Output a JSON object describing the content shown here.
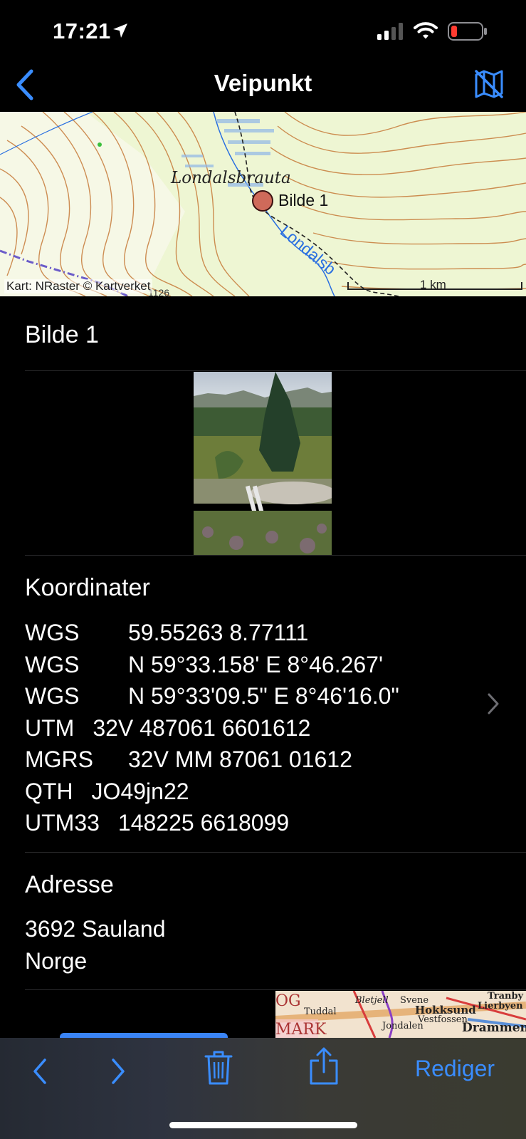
{
  "status_bar": {
    "time": "17:21"
  },
  "nav": {
    "title": "Veipunkt"
  },
  "map": {
    "place_label": "Londalsbrauta",
    "waypoint_label": "Bilde 1",
    "river_label": "Londalsb",
    "attribution": "Kart: NRaster © Kartverket",
    "scale_label": "1 km",
    "partial_label": "1126"
  },
  "waypoint": {
    "name": "Bilde 1"
  },
  "coordinates": {
    "heading": "Koordinater",
    "rows": [
      {
        "label": "WGS",
        "value": "59.55263  8.77111"
      },
      {
        "label": "WGS",
        "value": "N 59°33.158'  E 8°46.267'"
      },
      {
        "label": "WGS",
        "value": "N 59°33'09.5\"  E 8°46'16.0\""
      },
      {
        "label": "UTM",
        "value": "32V  487061  6601612"
      },
      {
        "label": "MGRS",
        "value": "32V  MM  87061  01612"
      },
      {
        "label": "QTH",
        "value": "JO49jn22"
      },
      {
        "label": "UTM33",
        "value": "148225  6618099"
      }
    ]
  },
  "address": {
    "heading": "Adresse",
    "line1": "3692 Sauland",
    "line2": "Norge"
  },
  "mini_map": {
    "labels": [
      "OG",
      "Tuddal",
      "MARK",
      "Bletjell",
      "Svene",
      "Hokksund",
      "Vestfossen",
      "Jondalen",
      "Tranby",
      "Lierbyen",
      "Drammen"
    ]
  },
  "toolbar": {
    "edit_label": "Rediger"
  },
  "colors": {
    "accent": "#3a8dff",
    "background": "#000000",
    "waypoint_marker": "#cf6a5a",
    "map_background": "#eef6d3"
  },
  "icons": {
    "back": "chevron-left-icon",
    "map_toggle": "map-off-icon",
    "trash": "trash-icon",
    "share": "share-icon",
    "prev": "chevron-left-icon",
    "next": "chevron-right-icon"
  }
}
